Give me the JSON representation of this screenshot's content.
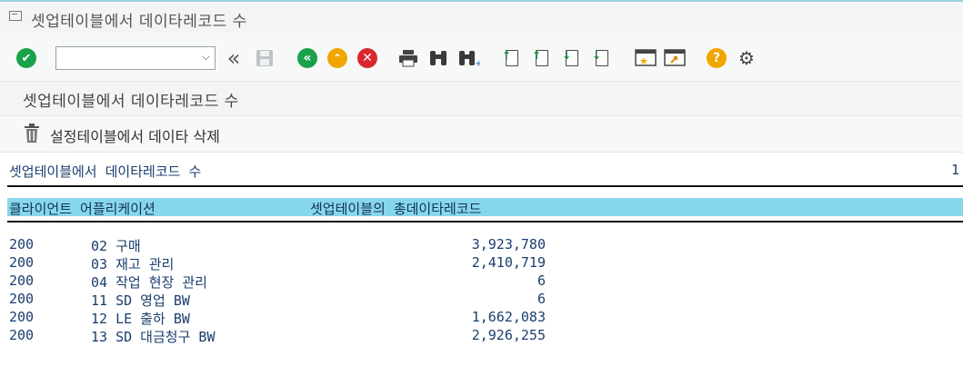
{
  "window": {
    "title": "셋업테이블에서 데이타레코드 수"
  },
  "toolbar": {
    "command_value": "",
    "icons": [
      "check-icon",
      "save-icon",
      "back-icon",
      "exit-icon",
      "cancel-icon",
      "print-icon",
      "find-icon",
      "find-next-icon",
      "first-page-icon",
      "previous-page-icon",
      "next-page-icon",
      "last-page-icon",
      "create-session-icon",
      "shortcut-icon",
      "help-icon",
      "settings-icon"
    ],
    "colors": {
      "green": "#1aa24a",
      "orange": "#f0a500",
      "red": "#d9262e"
    }
  },
  "app": {
    "title": "셋업테이블에서 데이타레코드 수",
    "action_label": "설정테이블에서 데이타 삭제"
  },
  "list": {
    "heading": "셋업테이블에서 데이타레코드 수",
    "page_number": "1",
    "columns": {
      "client_app": "클라이언트 어플리케이션",
      "records": "셋업테이블의 총데이타레코드"
    },
    "rows": [
      {
        "client": "200",
        "application": "02 구매",
        "records": "3,923,780"
      },
      {
        "client": "200",
        "application": "03 재고 관리",
        "records": "2,410,719"
      },
      {
        "client": "200",
        "application": "04 작업 현장 관리",
        "records": "6"
      },
      {
        "client": "200",
        "application": "11 SD 영업 BW",
        "records": "6"
      },
      {
        "client": "200",
        "application": "12 LE 출하 BW",
        "records": "1,662,083"
      },
      {
        "client": "200",
        "application": "13 SD 대금청구 BW",
        "records": "2,926,255"
      }
    ]
  }
}
